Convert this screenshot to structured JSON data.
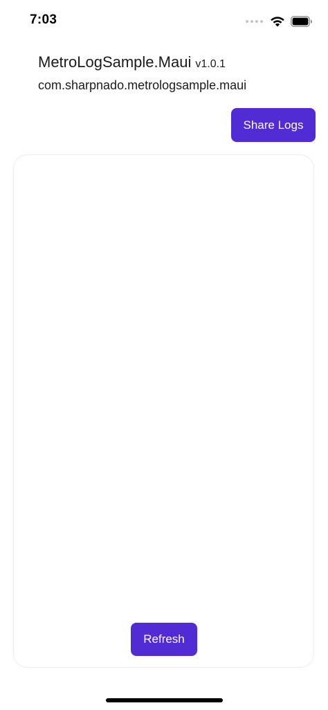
{
  "status_bar": {
    "time": "7:03",
    "icons": [
      "signal-dots-icon",
      "wifi-icon",
      "battery-icon"
    ]
  },
  "header": {
    "app_title": "MetroLogSample.Maui",
    "version": "v1.0.1",
    "package_name": "com.sharpnado.metrologsample.maui"
  },
  "actions": {
    "share_label": "Share Logs",
    "refresh_label": "Refresh"
  },
  "log_panel": {
    "content": ""
  },
  "colors": {
    "accent": "#512bd4",
    "background": "#ffffff",
    "panel_border": "#ececec"
  }
}
